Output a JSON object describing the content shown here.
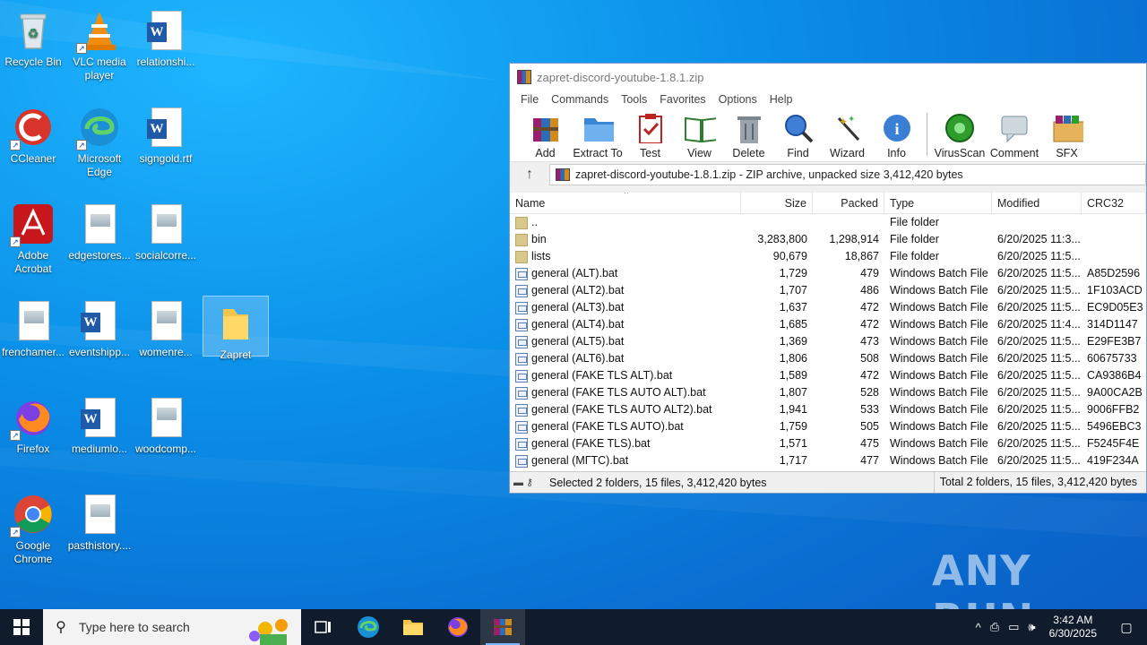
{
  "desktop": {
    "icons": [
      {
        "label": "Recycle Bin"
      },
      {
        "label": "VLC media player"
      },
      {
        "label": "relationshi..."
      },
      {
        "label": "CCleaner"
      },
      {
        "label": "Microsoft Edge"
      },
      {
        "label": "signgold.rtf"
      },
      {
        "label": "Adobe Acrobat"
      },
      {
        "label": "edgestores..."
      },
      {
        "label": "socialcorre..."
      },
      {
        "label": "frenchamer..."
      },
      {
        "label": "eventshipp..."
      },
      {
        "label": "womenre..."
      },
      {
        "label": "Zapret"
      },
      {
        "label": "Firefox"
      },
      {
        "label": "mediumlo..."
      },
      {
        "label": "woodcomp..."
      },
      {
        "label": "Google Chrome"
      },
      {
        "label": "pasthistory...."
      }
    ]
  },
  "window": {
    "title": "zapret-discord-youtube-1.8.1.zip",
    "menu": [
      "File",
      "Commands",
      "Tools",
      "Favorites",
      "Options",
      "Help"
    ],
    "toolbar": [
      "Add",
      "Extract To",
      "Test",
      "View",
      "Delete",
      "Find",
      "Wizard",
      "Info",
      "VirusScan",
      "Comment",
      "SFX"
    ],
    "address": "zapret-discord-youtube-1.8.1.zip - ZIP archive, unpacked size 3,412,420 bytes",
    "columns": {
      "name": "Name",
      "size": "Size",
      "packed": "Packed",
      "type": "Type",
      "modified": "Modified",
      "crc": "CRC32"
    },
    "rows": [
      {
        "name": "..",
        "size": "",
        "packed": "",
        "type": "File folder",
        "modified": "",
        "crc": "",
        "icon": "folder"
      },
      {
        "name": "bin",
        "size": "3,283,800",
        "packed": "1,298,914",
        "type": "File folder",
        "modified": "6/20/2025 11:3...",
        "crc": "",
        "icon": "folder"
      },
      {
        "name": "lists",
        "size": "90,679",
        "packed": "18,867",
        "type": "File folder",
        "modified": "6/20/2025 11:5...",
        "crc": "",
        "icon": "folder"
      },
      {
        "name": "general (ALT).bat",
        "size": "1,729",
        "packed": "479",
        "type": "Windows Batch File",
        "modified": "6/20/2025 11:5...",
        "crc": "A85D2596",
        "icon": "bat"
      },
      {
        "name": "general (ALT2).bat",
        "size": "1,707",
        "packed": "486",
        "type": "Windows Batch File",
        "modified": "6/20/2025 11:5...",
        "crc": "1F103ACD",
        "icon": "bat"
      },
      {
        "name": "general (ALT3).bat",
        "size": "1,637",
        "packed": "472",
        "type": "Windows Batch File",
        "modified": "6/20/2025 11:5...",
        "crc": "EC9D05E3",
        "icon": "bat"
      },
      {
        "name": "general (ALT4).bat",
        "size": "1,685",
        "packed": "472",
        "type": "Windows Batch File",
        "modified": "6/20/2025 11:4...",
        "crc": "314D1147",
        "icon": "bat"
      },
      {
        "name": "general (ALT5).bat",
        "size": "1,369",
        "packed": "473",
        "type": "Windows Batch File",
        "modified": "6/20/2025 11:5...",
        "crc": "E29FE3B7",
        "icon": "bat"
      },
      {
        "name": "general (ALT6).bat",
        "size": "1,806",
        "packed": "508",
        "type": "Windows Batch File",
        "modified": "6/20/2025 11:5...",
        "crc": "60675733",
        "icon": "bat"
      },
      {
        "name": "general (FAKE TLS ALT).bat",
        "size": "1,589",
        "packed": "472",
        "type": "Windows Batch File",
        "modified": "6/20/2025 11:5...",
        "crc": "CA9386B4",
        "icon": "bat"
      },
      {
        "name": "general (FAKE TLS AUTO ALT).bat",
        "size": "1,807",
        "packed": "528",
        "type": "Windows Batch File",
        "modified": "6/20/2025 11:5...",
        "crc": "9A00CA2B",
        "icon": "bat"
      },
      {
        "name": "general (FAKE TLS AUTO ALT2).bat",
        "size": "1,941",
        "packed": "533",
        "type": "Windows Batch File",
        "modified": "6/20/2025 11:5...",
        "crc": "9006FFB2",
        "icon": "bat"
      },
      {
        "name": "general (FAKE TLS AUTO).bat",
        "size": "1,759",
        "packed": "505",
        "type": "Windows Batch File",
        "modified": "6/20/2025 11:5...",
        "crc": "5496EBC3",
        "icon": "bat"
      },
      {
        "name": "general (FAKE TLS).bat",
        "size": "1,571",
        "packed": "475",
        "type": "Windows Batch File",
        "modified": "6/20/2025 11:5...",
        "crc": "F5245F4E",
        "icon": "bat"
      },
      {
        "name": "general (МГТС).bat",
        "size": "1,717",
        "packed": "477",
        "type": "Windows Batch File",
        "modified": "6/20/2025 11:5...",
        "crc": "419F234A",
        "icon": "bat"
      }
    ],
    "status_left": "Selected 2 folders, 15 files, 3,412,420 bytes",
    "status_right": "Total 2 folders, 15 files, 3,412,420 bytes"
  },
  "watermark": "ANY RUN",
  "taskbar": {
    "search_placeholder": "Type here to search",
    "time": "3:42 AM",
    "date": "6/30/2025"
  }
}
